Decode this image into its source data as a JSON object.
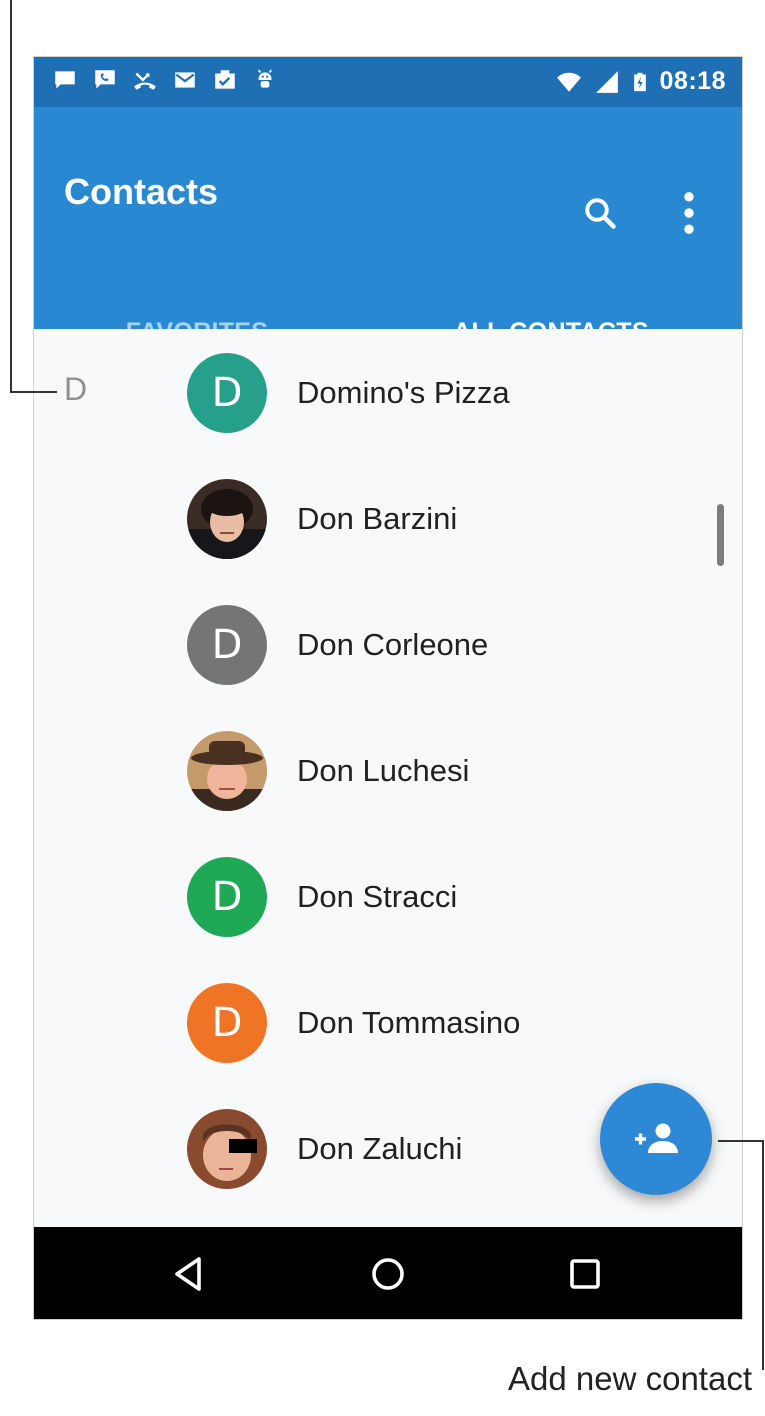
{
  "status_bar": {
    "time": "08:18"
  },
  "app_bar": {
    "title": "Contacts"
  },
  "tabs": [
    {
      "label": "FAVORITES",
      "selected": false
    },
    {
      "label": "ALL CONTACTS",
      "selected": true
    }
  ],
  "section": {
    "letter": "D"
  },
  "contacts": [
    {
      "name": "Domino's Pizza",
      "avatar_letter": "D",
      "avatar_color": "#26a08a"
    },
    {
      "name": "Don Barzini",
      "avatar_letter": "",
      "avatar_color": "#3a2b24"
    },
    {
      "name": "Don Corleone",
      "avatar_letter": "D",
      "avatar_color": "#757575"
    },
    {
      "name": "Don Luchesi",
      "avatar_letter": "",
      "avatar_color": "#6b4a32"
    },
    {
      "name": "Don Stracci",
      "avatar_letter": "D",
      "avatar_color": "#1fa855"
    },
    {
      "name": "Don Tommasino",
      "avatar_letter": "D",
      "avatar_color": "#ef7426"
    },
    {
      "name": "Don Zaluchi",
      "avatar_letter": "",
      "avatar_color": "#8a4a30"
    }
  ],
  "callouts": {
    "add_contact": "Add new contact"
  },
  "colors": {
    "status_bar": "#1f6fb5",
    "app_bar": "#2889d2",
    "fab": "#2d88d6"
  },
  "icons": {
    "search": "search-icon",
    "menu": "more-vert-icon",
    "fab": "add-person-icon",
    "back": "back-icon",
    "home": "home-icon",
    "recents": "recents-icon"
  }
}
